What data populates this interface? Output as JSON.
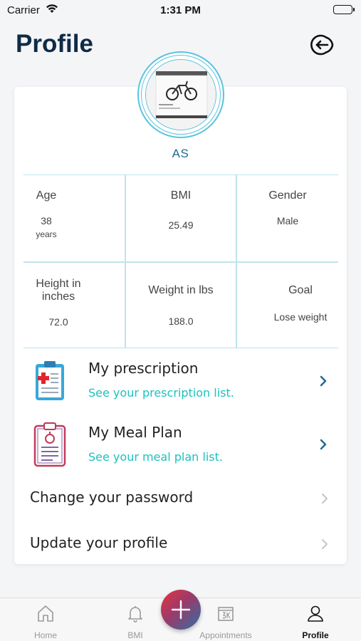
{
  "status_bar": {
    "carrier": "Carrier",
    "time": "1:31 PM"
  },
  "header": {
    "title": "Profile"
  },
  "user": {
    "initials": "AS"
  },
  "stats": {
    "age": {
      "label": "Age",
      "value": "38",
      "unit": "years"
    },
    "bmi": {
      "label": "BMI",
      "value": "25.49"
    },
    "gender": {
      "label": "Gender",
      "value": "Male"
    },
    "height": {
      "label_line1": "Height in",
      "label_line2": "inches",
      "value": "72.0"
    },
    "weight": {
      "label": "Weight in lbs",
      "value": "188.0"
    },
    "goal": {
      "label": "Goal",
      "value": "Lose weight"
    }
  },
  "menu": {
    "prescription": {
      "title": "My prescription",
      "subtitle": "See your prescription list."
    },
    "meal_plan": {
      "title": "My Meal Plan",
      "subtitle": "See your meal plan list."
    },
    "change_password": {
      "title": "Change your password"
    },
    "update_profile": {
      "title": "Update your profile"
    }
  },
  "tab_bar": {
    "home": "Home",
    "bmi": "BMI",
    "appointments": "Appointments",
    "profile": "Profile",
    "active": "profile"
  },
  "colors": {
    "title": "#0f2b46",
    "accent_teal": "#1ac2c0",
    "accent_blue": "#1f6b92",
    "grid_line": "#bfe3f1"
  }
}
